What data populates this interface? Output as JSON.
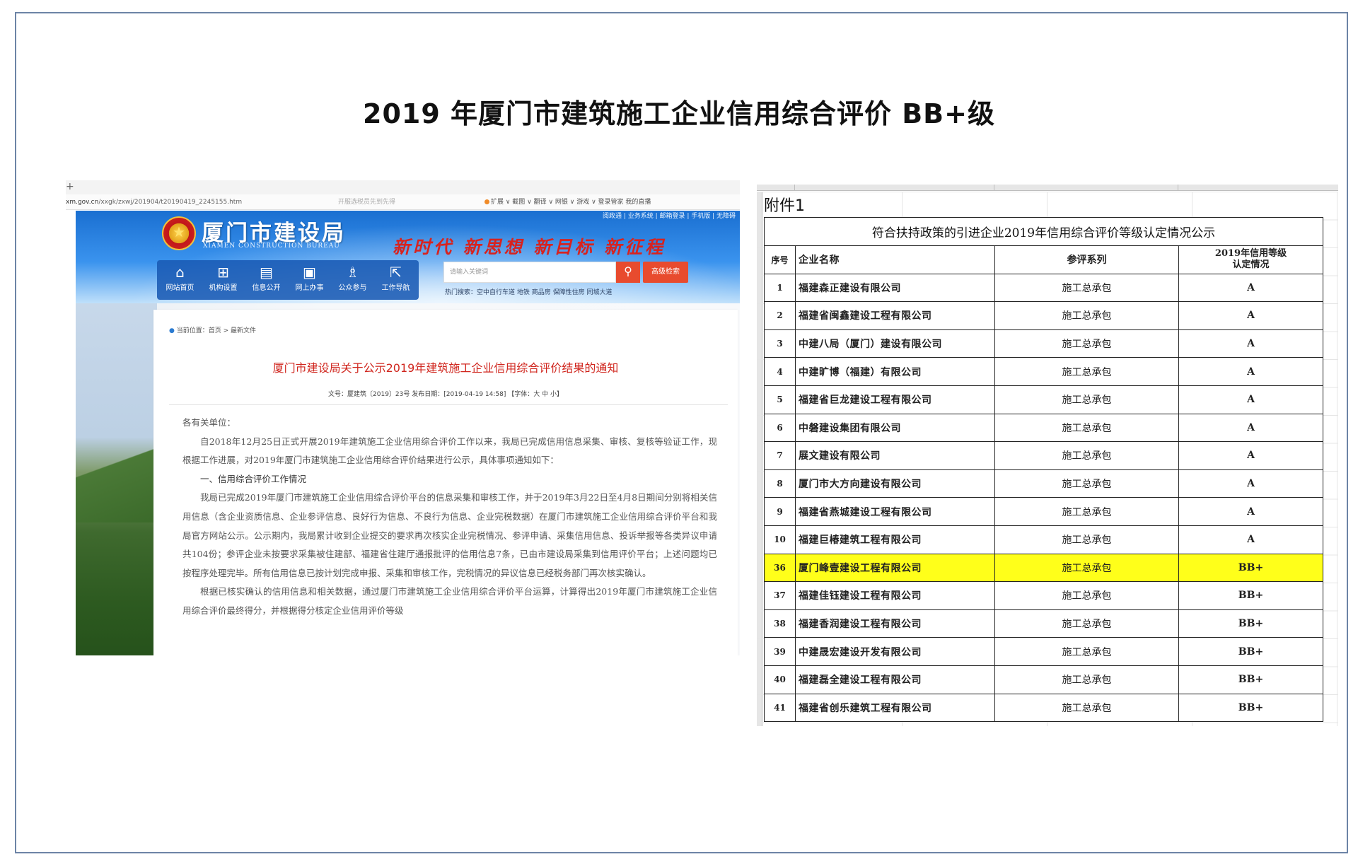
{
  "page_title": "2019 年厦门市建筑施工企业信用综合评价 BB+级",
  "website": {
    "tab_plus": "+",
    "address": {
      "url_prefix": "xm.gov.cn",
      "url_path": "/xxgk/zxwj/201904/t20190419_2245155.htm",
      "hint": "开服选税员先到先得",
      "tools": "扩展 ∨  截图 ∨  翻译 ∨  网银 ∨  游戏 ∨  登录管家  我的直播"
    },
    "top_links": "阅政通 | 业务系统 | 邮箱登录 | 手机版 | 无障碍",
    "site_name": "厦门市建设局",
    "site_name_en": "XIAMEN CONSTRUCTION BUREAU",
    "slogan": "新时代 新思想 新目标 新征程",
    "nav": [
      {
        "label": "网站首页",
        "icon": "home-icon",
        "glyph": "⌂"
      },
      {
        "label": "机构设置",
        "icon": "org-chart-icon",
        "glyph": "⊞"
      },
      {
        "label": "信息公开",
        "icon": "document-icon",
        "glyph": "▤"
      },
      {
        "label": "网上办事",
        "icon": "service-icon",
        "glyph": "▣"
      },
      {
        "label": "公众参与",
        "icon": "people-icon",
        "glyph": "♗"
      },
      {
        "label": "工作导航",
        "icon": "navigation-icon",
        "glyph": "⇱"
      }
    ],
    "search": {
      "placeholder": "请输入关键词",
      "button_glyph": "⚲",
      "advanced_label": "高级检索",
      "hot": "热门搜索：空中自行车道 地铁 商品房 保障性住房 同城大道"
    },
    "breadcrumb": "当前位置：首页 > 最新文件",
    "notice": {
      "title": "厦门市建设局关于公示2019年建筑施工企业信用综合评价结果的通知",
      "meta": "文号：厦建筑〔2019〕23号  发布日期：[2019-04-19 14:58]  【字体：大  中  小】",
      "salutation": "各有关单位：",
      "p1": "自2018年12月25日正式开展2019年建筑施工企业信用综合评价工作以来，我局已完成信用信息采集、审核、复核等验证工作，现根据工作进展，对2019年厦门市建筑施工企业信用综合评价结果进行公示，具体事项通知如下：",
      "h1": "一、信用综合评价工作情况",
      "p2": "我局已完成2019年厦门市建筑施工企业信用综合评价平台的信息采集和审核工作，并于2019年3月22日至4月8日期间分别将相关信用信息（含企业资质信息、企业参评信息、良好行为信息、不良行为信息、企业完税数据）在厦门市建筑施工企业信用综合评价平台和我局官方网站公示。公示期内，我局累计收到企业提交的要求再次核实企业完税情况、参评申请、采集信用信息、投诉举报等各类异议申请共104份；参评企业未按要求采集被住建部、福建省住建厅通报批评的信用信息7条，已由市建设局采集到信用评价平台；上述问题均已按程序处理完毕。所有信用信息已按计划完成申报、采集和审核工作，完税情况的异议信息已经税务部门再次核实确认。",
      "p3": "根据已核实确认的信用信息和相关数据，通过厦门市建筑施工企业信用综合评价平台运算，计算得出2019年厦门市建筑施工企业信用综合评价最终得分，并根据得分核定企业信用评价等级"
    }
  },
  "sheet": {
    "attachment": "附件1",
    "table_title": "符合扶持政策的引进企业2019年信用综合评价等级认定情况公示",
    "headers": {
      "no": "序号",
      "name": "企业名称",
      "category": "参评系列",
      "grade_line1": "2019年信用等级",
      "grade_line2": "认定情况"
    },
    "rows": [
      {
        "no": "1",
        "name": "福建森正建设有限公司",
        "category": "施工总承包",
        "grade": "A"
      },
      {
        "no": "2",
        "name": "福建省闽鑫建设工程有限公司",
        "category": "施工总承包",
        "grade": "A"
      },
      {
        "no": "3",
        "name": "中建八局（厦门）建设有限公司",
        "category": "施工总承包",
        "grade": "A"
      },
      {
        "no": "4",
        "name": "中建旷博（福建）有限公司",
        "category": "施工总承包",
        "grade": "A"
      },
      {
        "no": "5",
        "name": "福建省巨龙建设工程有限公司",
        "category": "施工总承包",
        "grade": "A"
      },
      {
        "no": "6",
        "name": "中磐建设集团有限公司",
        "category": "施工总承包",
        "grade": "A"
      },
      {
        "no": "7",
        "name": "展文建设有限公司",
        "category": "施工总承包",
        "grade": "A"
      },
      {
        "no": "8",
        "name": "厦门市大方向建设有限公司",
        "category": "施工总承包",
        "grade": "A"
      },
      {
        "no": "9",
        "name": "福建省燕城建设工程有限公司",
        "category": "施工总承包",
        "grade": "A"
      },
      {
        "no": "10",
        "name": "福建巨椿建筑工程有限公司",
        "category": "施工总承包",
        "grade": "A"
      },
      {
        "no": "36",
        "name": "厦门峰壹建设工程有限公司",
        "category": "施工总承包",
        "grade": "BB+",
        "highlight": true
      },
      {
        "no": "37",
        "name": "福建佳钰建设工程有限公司",
        "category": "施工总承包",
        "grade": "BB+"
      },
      {
        "no": "38",
        "name": "福建香润建设工程有限公司",
        "category": "施工总承包",
        "grade": "BB+"
      },
      {
        "no": "39",
        "name": "中建晟宏建设开发有限公司",
        "category": "施工总承包",
        "grade": "BB+"
      },
      {
        "no": "40",
        "name": "福建磊全建设工程有限公司",
        "category": "施工总承包",
        "grade": "BB+"
      },
      {
        "no": "41",
        "name": "福建省创乐建筑工程有限公司",
        "category": "施工总承包",
        "grade": "BB+"
      }
    ],
    "highlight_color": "#ffff1a"
  }
}
